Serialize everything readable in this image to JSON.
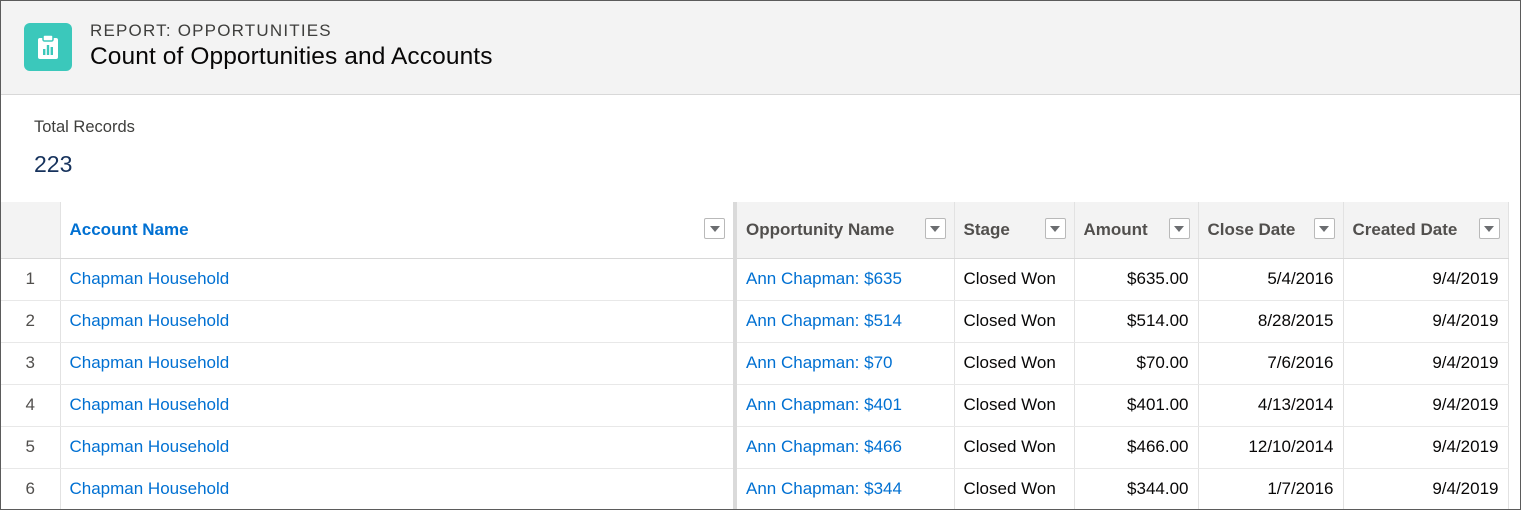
{
  "header": {
    "eyebrow": "REPORT: OPPORTUNITIES",
    "title": "Count of Opportunities and Accounts",
    "icon": "report-icon",
    "icon_color": "#3bc8bb"
  },
  "summary": {
    "label": "Total Records",
    "value": "223"
  },
  "table": {
    "columns": [
      {
        "label": "Account Name",
        "sorted": true
      },
      {
        "label": "Opportunity Name",
        "sorted": false
      },
      {
        "label": "Stage",
        "sorted": false
      },
      {
        "label": "Amount",
        "sorted": false
      },
      {
        "label": "Close Date",
        "sorted": false
      },
      {
        "label": "Created Date",
        "sorted": false
      }
    ],
    "rows": [
      {
        "num": "1",
        "account": "Chapman Household",
        "opportunity": "Ann Chapman: $635",
        "stage": "Closed Won",
        "amount": "$635.00",
        "close_date": "5/4/2016",
        "created_date": "9/4/2019"
      },
      {
        "num": "2",
        "account": "Chapman Household",
        "opportunity": "Ann Chapman: $514",
        "stage": "Closed Won",
        "amount": "$514.00",
        "close_date": "8/28/2015",
        "created_date": "9/4/2019"
      },
      {
        "num": "3",
        "account": "Chapman Household",
        "opportunity": "Ann Chapman: $70",
        "stage": "Closed Won",
        "amount": "$70.00",
        "close_date": "7/6/2016",
        "created_date": "9/4/2019"
      },
      {
        "num": "4",
        "account": "Chapman Household",
        "opportunity": "Ann Chapman: $401",
        "stage": "Closed Won",
        "amount": "$401.00",
        "close_date": "4/13/2014",
        "created_date": "9/4/2019"
      },
      {
        "num": "5",
        "account": "Chapman Household",
        "opportunity": "Ann Chapman: $466",
        "stage": "Closed Won",
        "amount": "$466.00",
        "close_date": "12/10/2014",
        "created_date": "9/4/2019"
      },
      {
        "num": "6",
        "account": "Chapman Household",
        "opportunity": "Ann Chapman: $344",
        "stage": "Closed Won",
        "amount": "$344.00",
        "close_date": "1/7/2016",
        "created_date": "9/4/2019"
      }
    ]
  },
  "colors": {
    "link": "#0070d2",
    "header_bg": "#f3f3f3"
  }
}
